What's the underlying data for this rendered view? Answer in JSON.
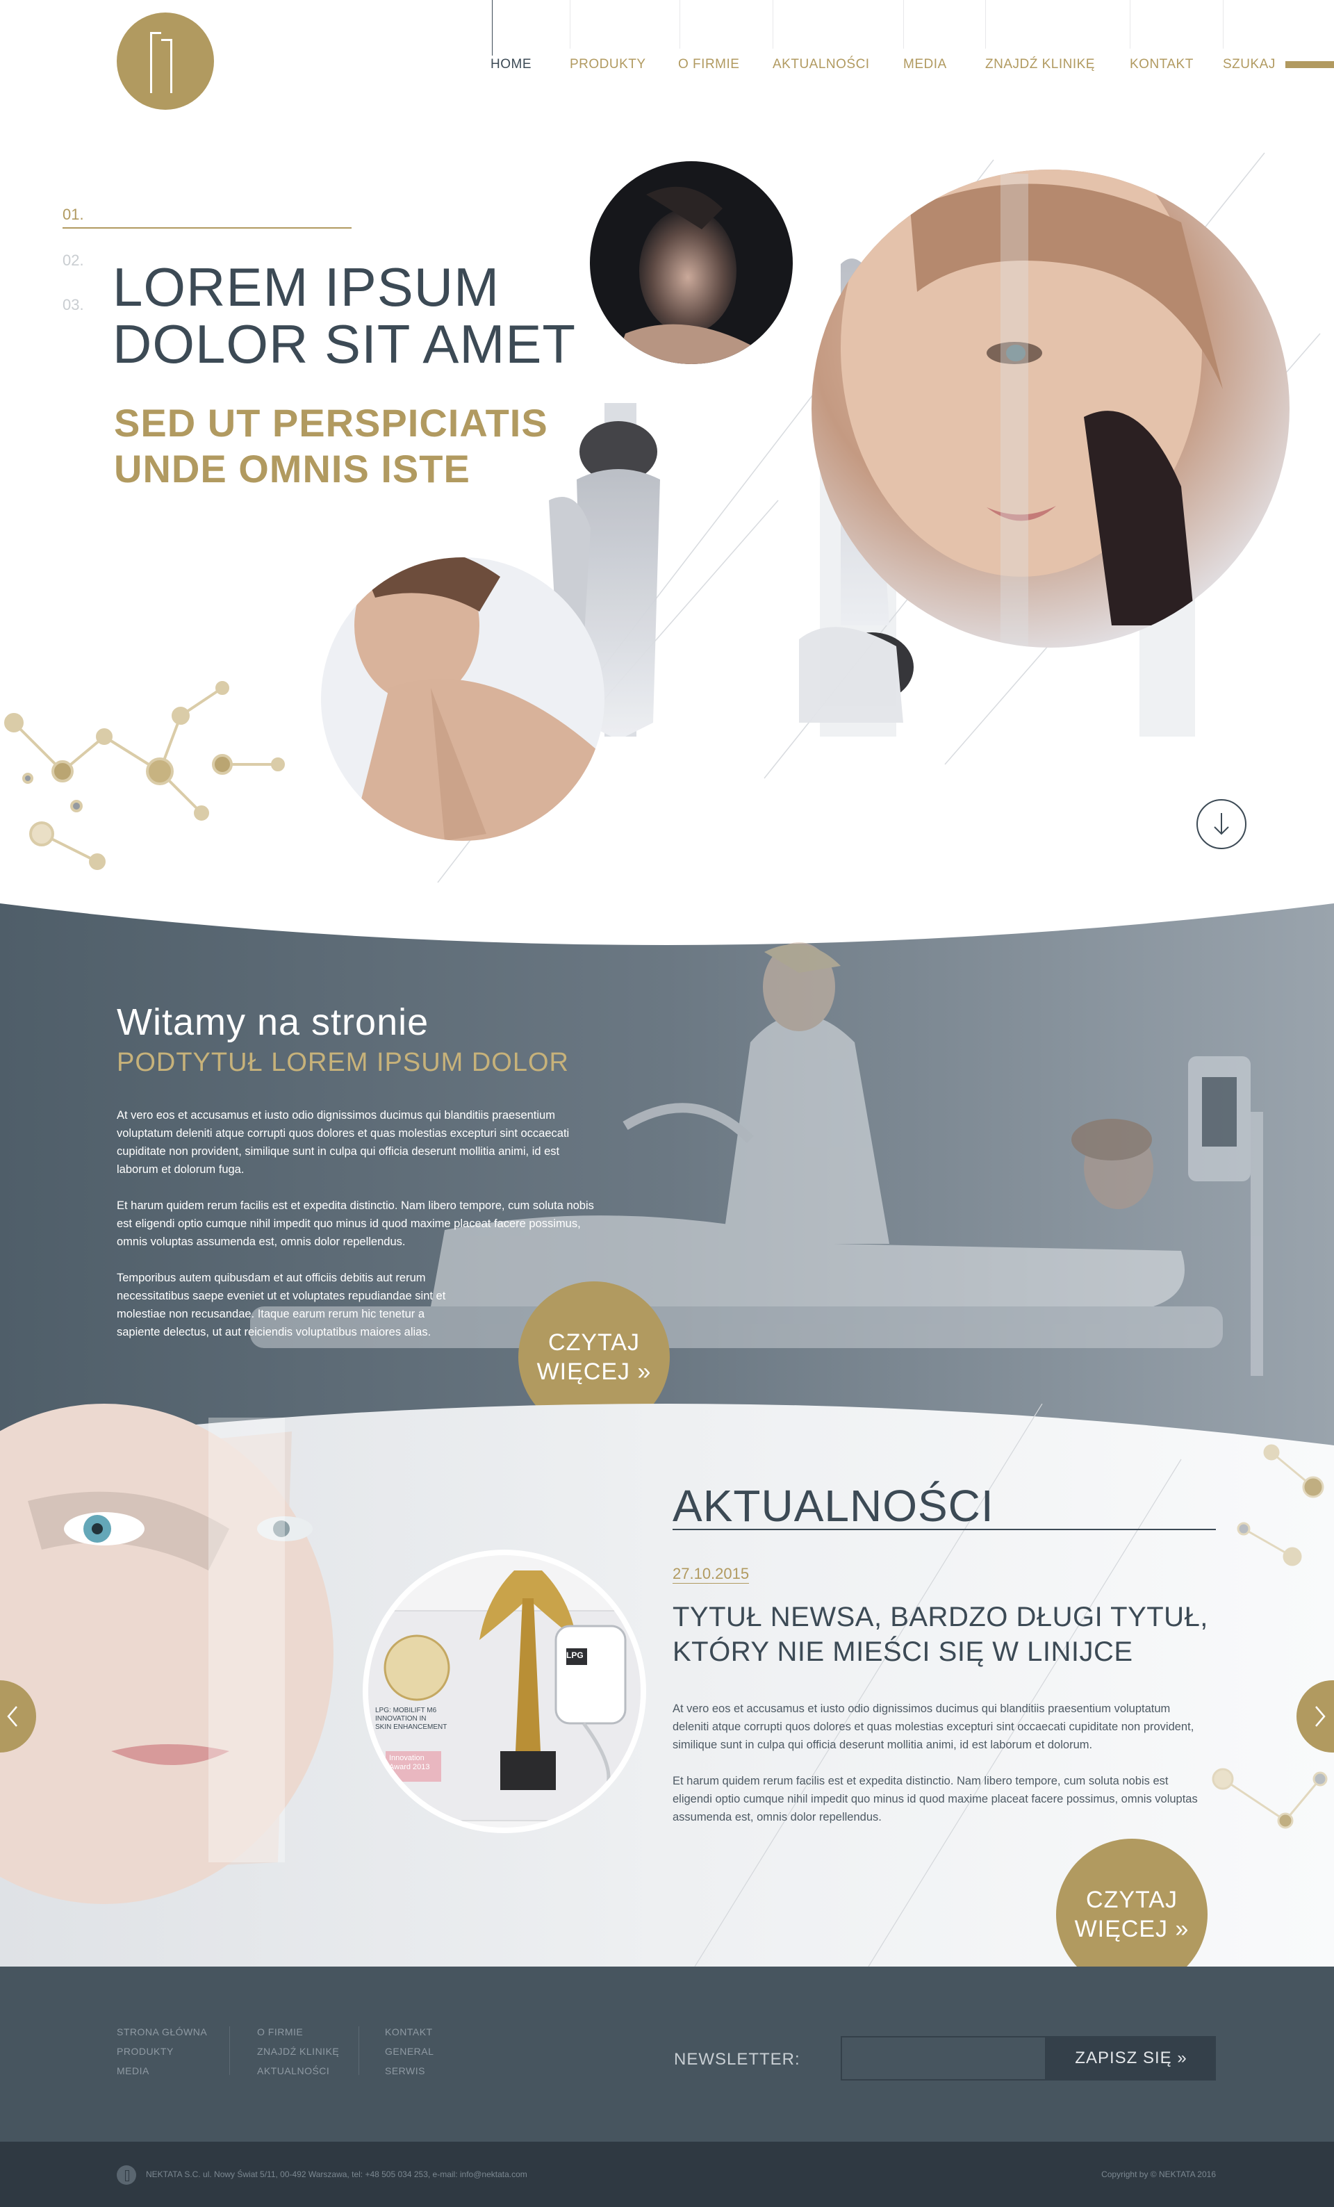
{
  "brand": {
    "logo_icon": "nektata-logo-icon",
    "accent": "#b19a60",
    "dark": "#3c4a55"
  },
  "nav": {
    "items": [
      {
        "label": "HOME",
        "active": true
      },
      {
        "label": "PRODUKTY"
      },
      {
        "label": "O FIRMIE"
      },
      {
        "label": "AKTUALNOŚCI"
      },
      {
        "label": "MEDIA"
      },
      {
        "label": "ZNAJDŹ KLINIKĘ"
      },
      {
        "label": "KONTAKT"
      },
      {
        "label": "SZUKAJ"
      }
    ]
  },
  "hero": {
    "slides": [
      "01.",
      "02.",
      "03."
    ],
    "active_slide": 0,
    "title_line1": "LOREM IPSUM",
    "title_line2": "DOLOR SIT AMET",
    "subtitle_line1": "SED UT PERSPICIATIS",
    "subtitle_line2": "UNDE OMNIS ISTE",
    "scroll_icon": "arrow-down-circle-icon"
  },
  "welcome": {
    "title": "Witamy na stronie",
    "subtitle": "PODTYTUŁ LOREM IPSUM DOLOR",
    "paragraphs": [
      "At vero eos et accusamus et iusto odio dignissimos ducimus qui blanditiis praesentium voluptatum deleniti atque corrupti quos dolores et quas molestias excepturi sint occaecati cupiditate non provident, similique sunt in culpa qui officia deserunt mollitia animi, id est laborum et dolorum fuga.",
      "Et harum quidem rerum facilis est et expedita distinctio. Nam libero tempore, cum soluta nobis est eligendi optio cumque nihil impedit quo minus id quod maxime placeat facere possimus, omnis voluptas assumenda est, omnis dolor repellendus.",
      "Temporibus autem quibusdam et aut officiis debitis aut rerum necessitatibus saepe eveniet ut et voluptates repudiandae sint et molestiae non recusandae. Itaque earum rerum hic tenetur a sapiente delectus, ut aut reiciendis voluptatibus maiores alias."
    ],
    "more_line1": "CZYTAJ",
    "more_line2": "WIĘCEJ »"
  },
  "news": {
    "section_title": "AKTUALNOŚCI",
    "date": "27.10.2015",
    "headline": "TYTUŁ NEWSA, BARDZO DŁUGI TYTUŁ, KTÓRY NIE MIEŚCI SIĘ W LINIJCE",
    "paragraphs": [
      "At vero eos et accusamus et iusto odio dignissimos ducimus qui blanditiis praesentium voluptatum deleniti atque corrupti quos dolores et quas molestias excepturi sint occaecati cupiditate non provident, similique sunt in culpa qui officia deserunt mollitia animi, id est laborum et dolorum.",
      "Et harum quidem rerum facilis est et expedita distinctio. Nam libero tempore, cum soluta nobis est eligendi optio cumque nihil impedit quo minus id quod maxime placeat facere possimus, omnis voluptas assumenda est, omnis dolor repellendus."
    ],
    "award_text": {
      "device": "LPG",
      "caption1": "LPG: MOBILIFT M6",
      "caption2": "INNOVATION IN",
      "caption3": "SKIN ENHANCEMENT",
      "award1": "Innovation",
      "award2": "Award 2013"
    },
    "more_line1": "CZYTAJ",
    "more_line2": "WIĘCEJ »",
    "prev_icon": "chevron-left-icon",
    "next_icon": "chevron-right-icon"
  },
  "footer": {
    "col1": [
      "STRONA GŁÓWNA",
      "PRODUKTY",
      "MEDIA"
    ],
    "col2": [
      "O FIRMIE",
      "ZNAJDŹ KLINIKĘ",
      "AKTUALNOŚCI"
    ],
    "col3": [
      "KONTAKT",
      "GENERAL",
      "SERWIS"
    ],
    "newsletter_label": "NEWSLETTER:",
    "newsletter_placeholder": "",
    "newsletter_button": "ZAPISZ SIĘ »"
  },
  "bottom": {
    "address": "NEKTATA S.C. ul. Nowy Świat 5/11, 00-492 Warszawa, tel: +48 505 034 253, e-mail: info@nektata.com",
    "copyright": "Copyright by © NEKTATA 2016"
  }
}
